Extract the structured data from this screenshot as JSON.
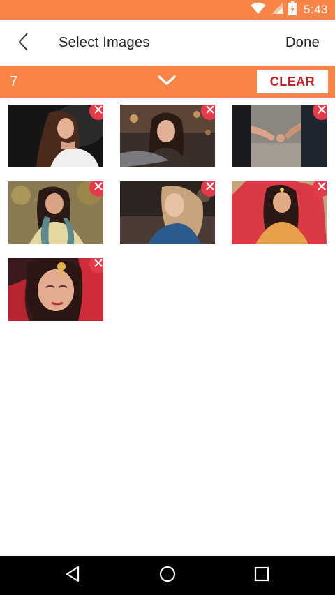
{
  "status_bar": {
    "time": "5:43",
    "icons": [
      "wifi-icon",
      "signal-icon",
      "battery-icon"
    ],
    "color": "#f88547"
  },
  "app_bar": {
    "title": "Select Images",
    "back_icon": "back-chevron-icon",
    "done_label": "Done"
  },
  "selection_bar": {
    "count": "7",
    "toggle_icon": "chevron-down-icon",
    "clear_label": "CLEAR",
    "color": "#f88547",
    "clear_color": "#c7202a"
  },
  "images": [
    {
      "name": "portrait-woman-dark-background",
      "remove_icon": "close-icon"
    },
    {
      "name": "woman-at-night-city",
      "remove_icon": "close-icon"
    },
    {
      "name": "couple-holding-hands",
      "remove_icon": "close-icon"
    },
    {
      "name": "woman-with-braid-outdoors",
      "remove_icon": "close-icon"
    },
    {
      "name": "woman-smiling-blonde",
      "remove_icon": "close-icon"
    },
    {
      "name": "bride-red-veil",
      "remove_icon": "close-icon"
    },
    {
      "name": "bride-closeup-makeup",
      "remove_icon": "close-icon"
    }
  ],
  "nav_bar": {
    "items": [
      "back-triangle-icon",
      "home-circle-icon",
      "recents-square-icon"
    ]
  }
}
